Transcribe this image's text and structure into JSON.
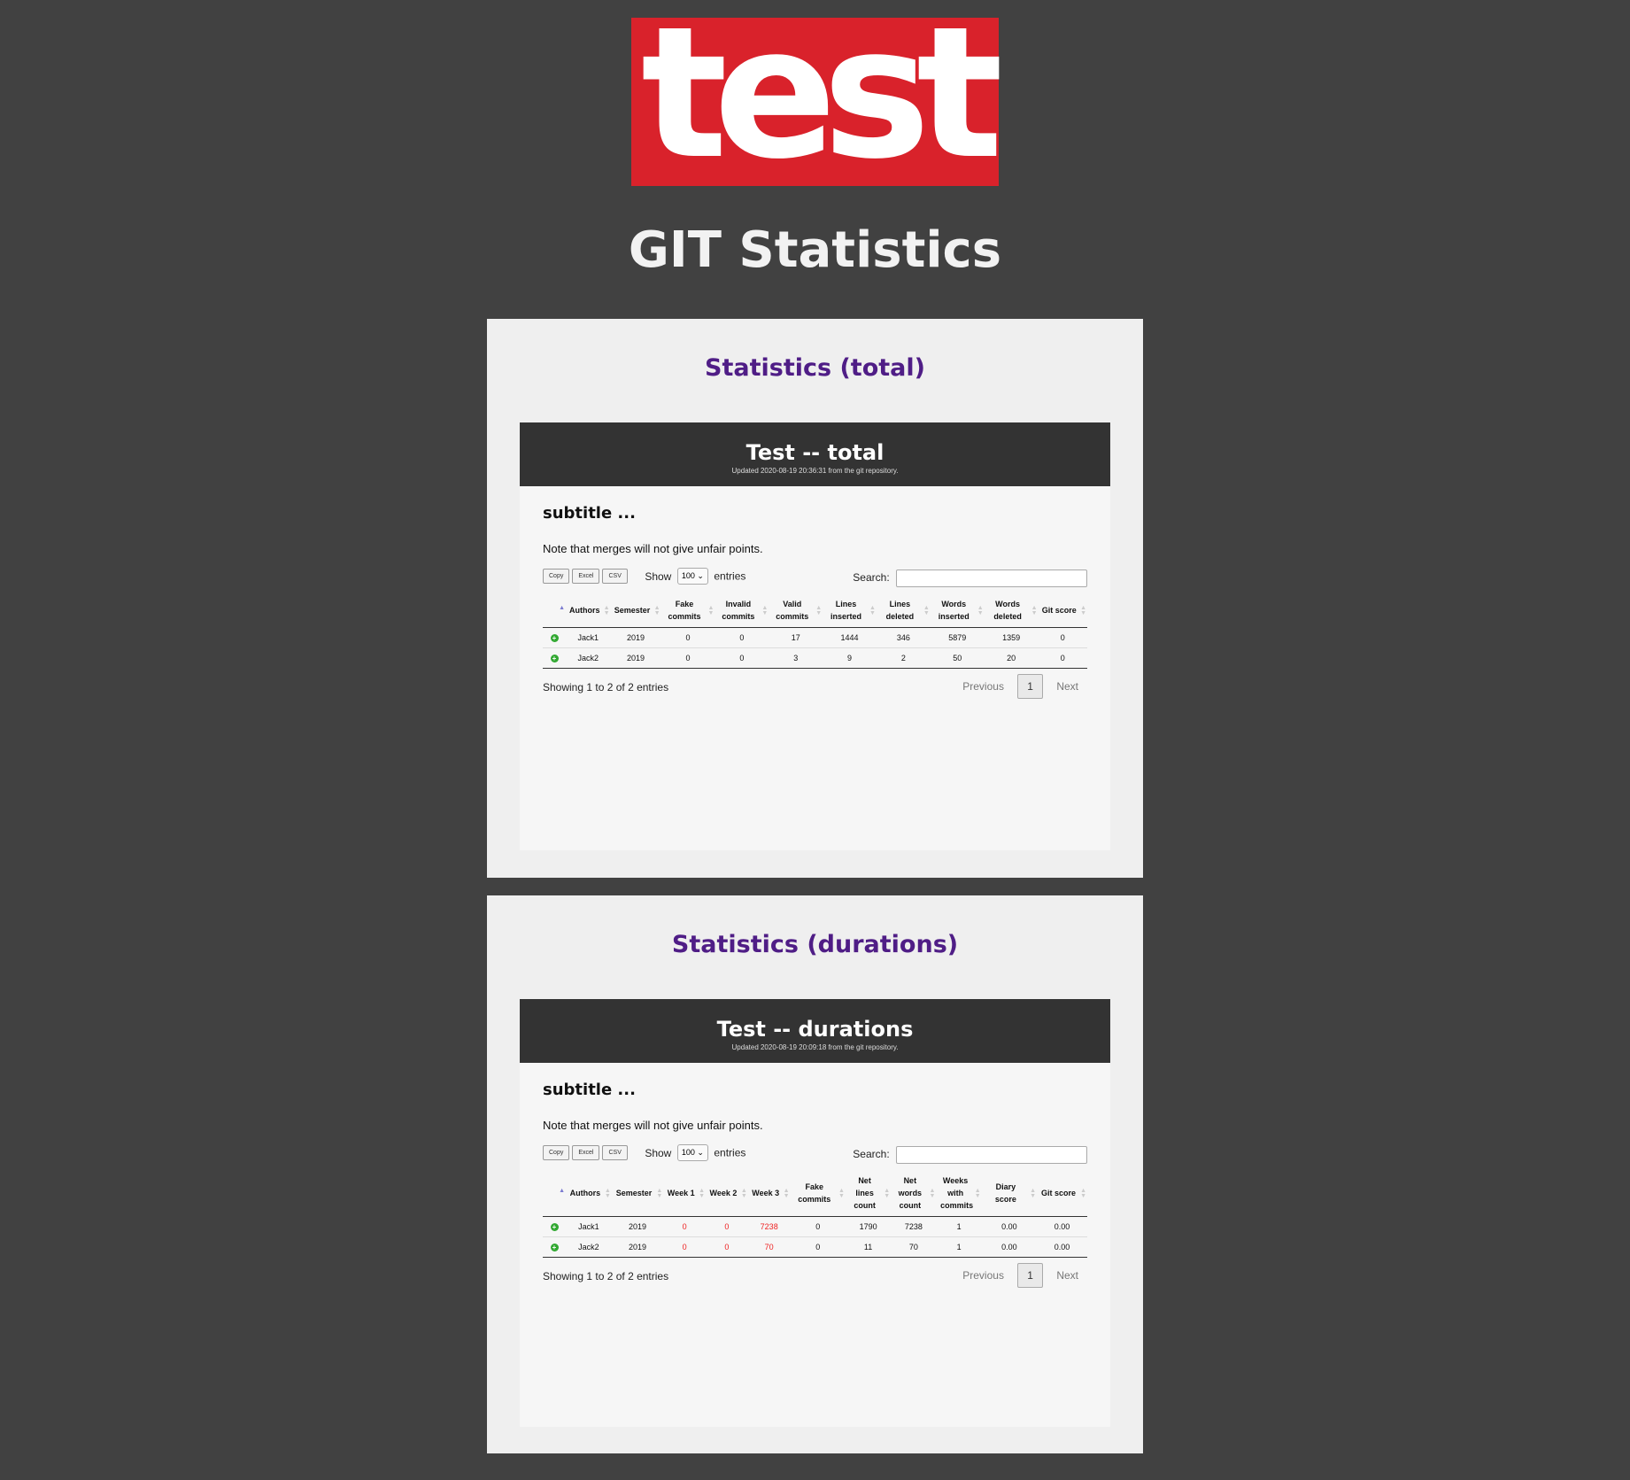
{
  "logo": {
    "text": "test",
    "color": "#d9222b"
  },
  "page_title": "GIT Statistics",
  "panels": [
    {
      "heading": "Statistics (total)",
      "report_title": "Test -- total",
      "updated": "Updated 2020-08-19 20:36:31 from the git repository.",
      "subtitle": "subtitle ...",
      "note": "Note that merges will not give unfair points.",
      "buttons": {
        "copy": "Copy",
        "excel": "Excel",
        "csv": "CSV"
      },
      "show_label": "Show",
      "page_length": "100",
      "entries_label": "entries",
      "search_label": "Search:",
      "columns": [
        "Authors",
        "Semester",
        "Fake commits",
        "Invalid commits",
        "Valid commits",
        "Lines inserted",
        "Lines deleted",
        "Words inserted",
        "Words deleted",
        "Git score"
      ],
      "rows": [
        [
          "Jack1",
          "2019",
          "0",
          "0",
          "17",
          "1444",
          "346",
          "5879",
          "1359",
          "0"
        ],
        [
          "Jack2",
          "2019",
          "0",
          "0",
          "3",
          "9",
          "2",
          "50",
          "20",
          "0"
        ]
      ],
      "info": "Showing 1 to 2 of 2 entries",
      "pager": {
        "previous": "Previous",
        "page": "1",
        "next": "Next"
      }
    },
    {
      "heading": "Statistics (durations)",
      "report_title": "Test -- durations",
      "updated": "Updated 2020-08-19 20:09:18 from the git repository.",
      "subtitle": "subtitle ...",
      "note": "Note that merges will not give unfair points.",
      "buttons": {
        "copy": "Copy",
        "excel": "Excel",
        "csv": "CSV"
      },
      "show_label": "Show",
      "page_length": "100",
      "entries_label": "entries",
      "search_label": "Search:",
      "columns": [
        "Authors",
        "Semester",
        "Week 1",
        "Week 2",
        "Week 3",
        "Fake commits",
        "Net lines count",
        "Net words count",
        "Weeks with commits",
        "Diary score",
        "Git score"
      ],
      "rows": [
        [
          "Jack1",
          "2019",
          "0",
          "0",
          "7238",
          "0",
          "1790",
          "7238",
          "1",
          "0.00",
          "0.00"
        ],
        [
          "Jack2",
          "2019",
          "0",
          "0",
          "70",
          "0",
          "11",
          "70",
          "1",
          "0.00",
          "0.00"
        ]
      ],
      "red_columns": [
        2,
        3,
        4
      ],
      "info": "Showing 1 to 2 of 2 entries",
      "pager": {
        "previous": "Previous",
        "page": "1",
        "next": "Next"
      }
    }
  ],
  "colors": {
    "background": "#414141",
    "panel": "#efefef",
    "heading": "#4f1d86",
    "report_header": "#333333",
    "highlight_value": "#ee2222",
    "expand_icon": "#31a831"
  }
}
